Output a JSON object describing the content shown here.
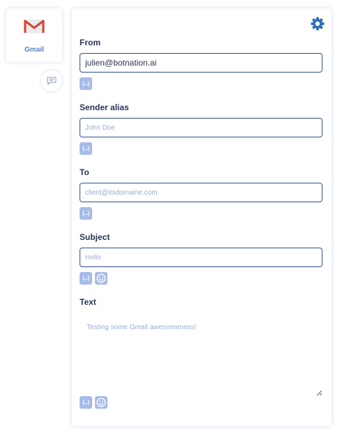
{
  "app": {
    "name": "Gmail",
    "icon": "gmail-logo-icon"
  },
  "sidebar": {
    "chat_icon": "chat-bubble-icon"
  },
  "form": {
    "settings_icon": "gear-icon",
    "from": {
      "label": "From",
      "value": "julien@botnation.ai"
    },
    "sender_alias": {
      "label": "Sender alias",
      "placeholder": "John Doe"
    },
    "to": {
      "label": "To",
      "placeholder": "client@itsdomaine.com"
    },
    "subject": {
      "label": "Subject",
      "placeholder": "Hello"
    },
    "text": {
      "label": "Text",
      "placeholder": "Testing some Gmail awesomeness!"
    },
    "variable_button_label": "{...}",
    "emoji_icon": "smiley-icon"
  },
  "colors": {
    "accent": "#2e70b8",
    "label": "#263455",
    "border": "#2e4e8c",
    "tool_button": "#a6bce8",
    "placeholder": "#9aaed0",
    "gmail_red": "#d44638"
  }
}
